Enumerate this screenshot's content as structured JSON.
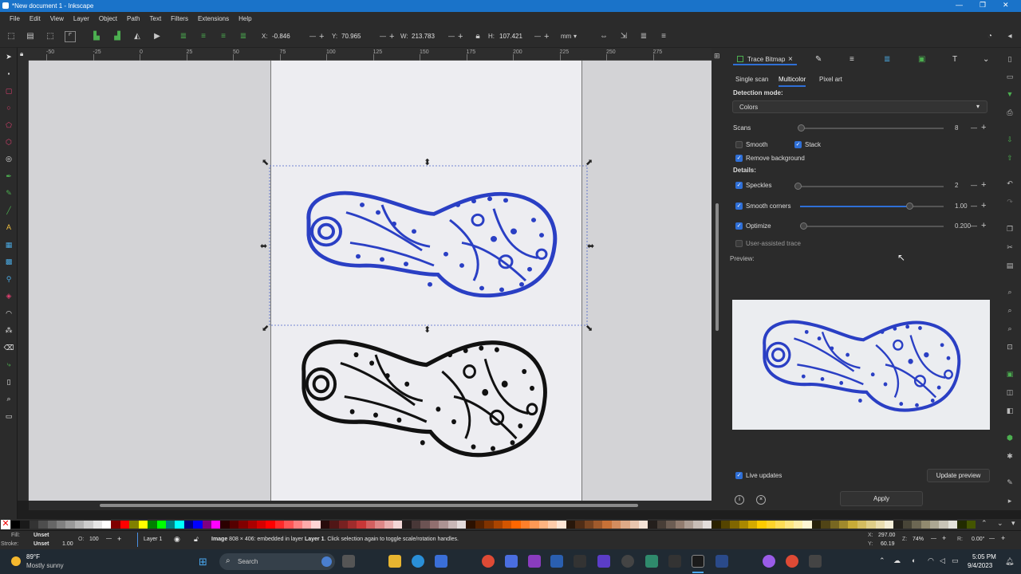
{
  "window": {
    "title": "*New document 1 - Inkscape",
    "controls": [
      "—",
      "❐",
      "✕"
    ]
  },
  "menu": [
    "File",
    "Edit",
    "View",
    "Layer",
    "Object",
    "Path",
    "Text",
    "Filters",
    "Extensions",
    "Help"
  ],
  "toolbar": {
    "x_label": "X:",
    "x_value": "-0.846",
    "y_label": "Y:",
    "y_value": "70.965",
    "w_label": "W:",
    "w_value": "213.783",
    "h_label": "H:",
    "h_value": "107.421",
    "units": "mm",
    "minus": "—",
    "plus": "+"
  },
  "ruler_ticks": [
    "-50",
    "-25",
    "0",
    "25",
    "50",
    "75",
    "100",
    "125",
    "150",
    "175",
    "200",
    "225",
    "250",
    "275"
  ],
  "panel": {
    "dialog_tab": "Trace Bitmap",
    "close": "×",
    "mode_tabs": [
      "Single scan",
      "Multicolor",
      "Pixel art"
    ],
    "active_mode": "Multicolor",
    "detection_mode_label": "Detection mode:",
    "detection_mode_value": "Colors",
    "scans_label": "Scans",
    "scans_value": "8",
    "smooth_label": "Smooth",
    "stack_label": "Stack",
    "remove_bg_label": "Remove background",
    "details_label": "Details:",
    "speckles_label": "Speckles",
    "speckles_value": "2",
    "smooth_corners_label": "Smooth corners",
    "smooth_corners_value": "1.00",
    "smooth_corners_level": 0.76,
    "optimize_label": "Optimize",
    "optimize_value": "0.200",
    "user_assisted_label": "User-assisted trace",
    "preview_label": "Preview:",
    "live_updates_label": "Live updates",
    "update_preview_label": "Update preview",
    "apply_label": "Apply"
  },
  "status": {
    "fill_label": "Fill:",
    "fill_value": "Unset",
    "stroke_label": "Stroke:",
    "stroke_value": "Unset",
    "stroke_width": "1.00",
    "opacity_label": "O:",
    "opacity_value": "100",
    "layer": "Layer 1",
    "message_bold": "Image",
    "message_text": " 808 × 406: embedded in layer ",
    "message_layer": "Layer 1",
    "message_tail": ". Click selection again to toggle scale/rotation handles.",
    "cursor_x_label": "X:",
    "cursor_x": "297.00",
    "cursor_y_label": "Y:",
    "cursor_y": "60.19",
    "zoom_label": "Z:",
    "zoom": "74%",
    "rotation_label": "R:",
    "rotation": "0.00°"
  },
  "taskbar": {
    "weather_temp": "89°F",
    "weather_desc": "Mostly sunny",
    "search_placeholder": "Search",
    "time": "5:05 PM",
    "date": "9/4/2023"
  },
  "colors": {
    "accent": "#2f6fd6",
    "titlebar": "#1a73c9",
    "ink_blue": "#2a3fc4",
    "ink_black": "#111111"
  },
  "palette": [
    "#000000",
    "#1a1a1a",
    "#333333",
    "#4d4d4d",
    "#666666",
    "#808080",
    "#999999",
    "#b3b3b3",
    "#cccccc",
    "#e6e6e6",
    "#ffffff",
    "#800000",
    "#ff0000",
    "#808000",
    "#ffff00",
    "#008000",
    "#00ff00",
    "#008080",
    "#00ffff",
    "#000080",
    "#0000ff",
    "#800080",
    "#ff00ff",
    "#2b0000",
    "#550000",
    "#800000",
    "#aa0000",
    "#d40000",
    "#ff0000",
    "#ff2a2a",
    "#ff5555",
    "#ff8080",
    "#ffaaaa",
    "#ffd5d5",
    "#280b0b",
    "#501616",
    "#782121",
    "#a02c2c",
    "#c83737",
    "#d35f5f",
    "#de8787",
    "#e9afaf",
    "#f4d7d7",
    "#241c1c",
    "#483737",
    "#6c5353",
    "#916f6f",
    "#ac9393",
    "#c8b7b7",
    "#e3dbdb",
    "#2b1100",
    "#552200",
    "#803300",
    "#aa4400",
    "#d45500",
    "#ff6600",
    "#ff7f2a",
    "#ff9955",
    "#ffb380",
    "#ffccaa",
    "#ffe6d5",
    "#28170b",
    "#502d16",
    "#784421",
    "#a05a2c",
    "#c87137",
    "#d38d5f",
    "#deaa87",
    "#e9c6af",
    "#f4e3d7",
    "#241f1c",
    "#483e37",
    "#6c5d53",
    "#917c6f",
    "#ac9d93",
    "#c8beb7",
    "#e3dedb",
    "#2b2200",
    "#554400",
    "#806600",
    "#aa8800",
    "#d4aa00",
    "#ffcc00",
    "#ffd42a",
    "#ffdd55",
    "#ffe680",
    "#ffeeaa",
    "#fff6d5",
    "#28220b",
    "#504416",
    "#786721",
    "#a0892c",
    "#c8ab37",
    "#d3bc5f",
    "#decd87",
    "#e9ddaf",
    "#f4eed7",
    "#24221c",
    "#484537",
    "#6c6753",
    "#918a6f",
    "#aca793",
    "#c8c4b7",
    "#e3e2db",
    "#222b00",
    "#445500"
  ]
}
